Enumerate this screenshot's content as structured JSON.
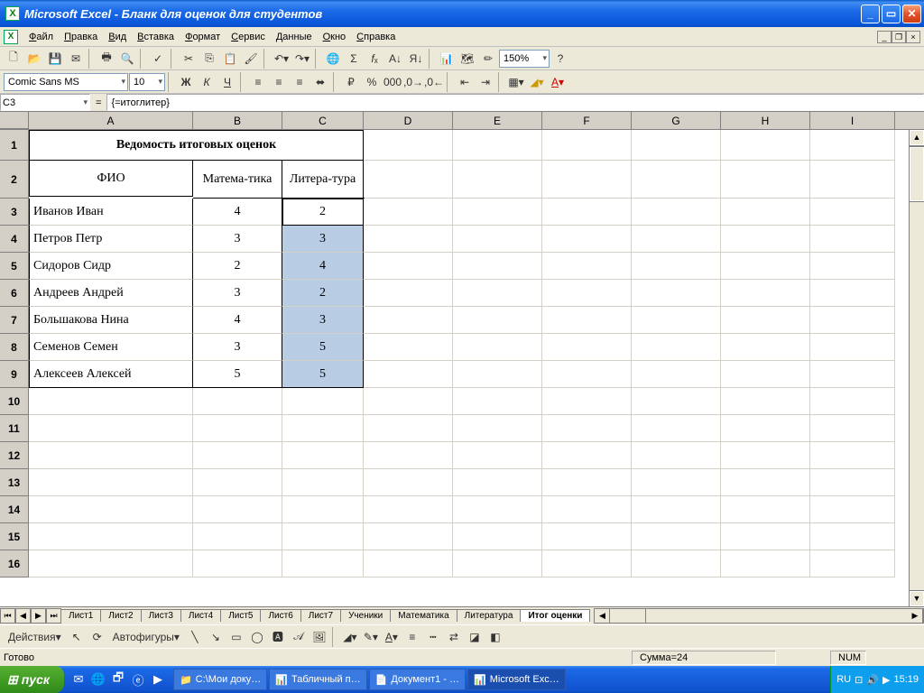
{
  "window": {
    "app": "Microsoft Excel",
    "doc": "Бланк для оценок для студентов"
  },
  "menu": [
    "Файл",
    "Правка",
    "Вид",
    "Вставка",
    "Формат",
    "Сервис",
    "Данные",
    "Окно",
    "Справка"
  ],
  "namebox": "C3",
  "formula": "{=итоглитер}",
  "font": {
    "name": "Comic Sans MS",
    "size": "10"
  },
  "zoom": "150%",
  "columns": [
    "A",
    "B",
    "C",
    "D",
    "E",
    "F",
    "G",
    "H",
    "I"
  ],
  "title_row": "Ведомость итоговых оценок",
  "headers": {
    "fio": "ФИО",
    "math": "Матема-тика",
    "lit": "Литера-тура"
  },
  "students": [
    {
      "name": "Иванов Иван",
      "math": "4",
      "lit": "2"
    },
    {
      "name": "Петров Петр",
      "math": "3",
      "lit": "3"
    },
    {
      "name": "Сидоров Сидр",
      "math": "2",
      "lit": "4"
    },
    {
      "name": "Андреев Андрей",
      "math": "3",
      "lit": "2"
    },
    {
      "name": "Большакова Нина",
      "math": "4",
      "lit": "3"
    },
    {
      "name": "Семенов Семен",
      "math": "3",
      "lit": "5"
    },
    {
      "name": "Алексеев Алексей",
      "math": "5",
      "lit": "5"
    }
  ],
  "sheets": [
    "Лист1",
    "Лист2",
    "Лист3",
    "Лист4",
    "Лист5",
    "Лист6",
    "Лист7",
    "Ученики",
    "Математика",
    "Литература",
    "Итог оценки"
  ],
  "active_sheet": "Итог оценки",
  "drawbar": {
    "actions": "Действия",
    "autoshapes": "Автофигуры"
  },
  "status": {
    "ready": "Готово",
    "sum": "Сумма=24",
    "num": "NUM"
  },
  "taskbar": {
    "start": "пуск",
    "items": [
      {
        "icon": "📁",
        "label": "С:\\Мои доку…"
      },
      {
        "icon": "📊",
        "label": "Табличный п…"
      },
      {
        "icon": "📄",
        "label": "Документ1 - …"
      },
      {
        "icon": "📊",
        "label": "Microsoft Exc…"
      }
    ],
    "lang": "RU",
    "time": "15:19"
  }
}
